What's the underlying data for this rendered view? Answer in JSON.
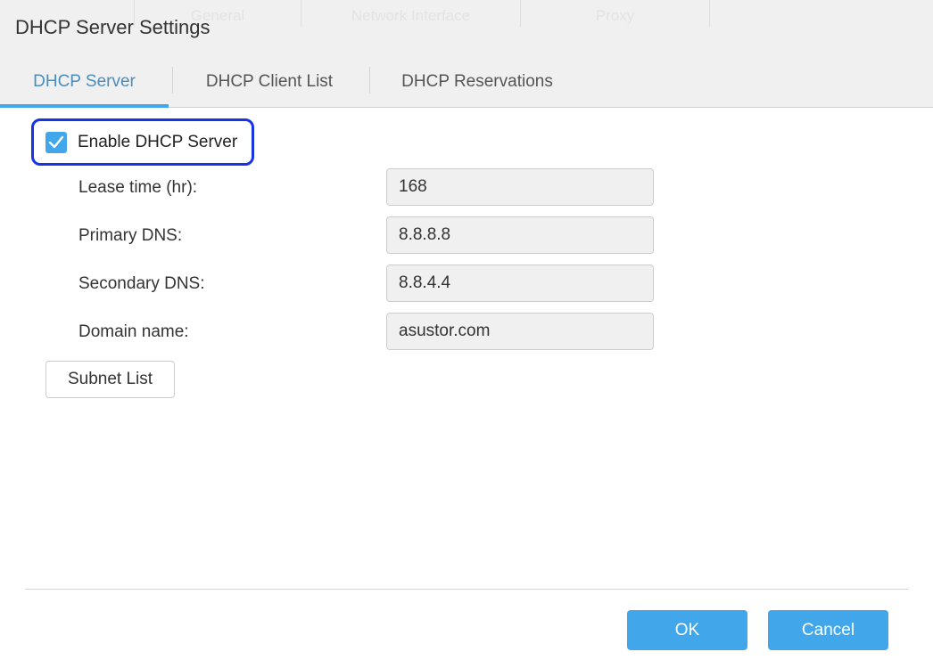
{
  "window": {
    "title": "DHCP Server Settings",
    "background_tabs": [
      "General",
      "Network Interface",
      "Proxy"
    ]
  },
  "tabs": [
    {
      "label": "DHCP Server",
      "active": true
    },
    {
      "label": "DHCP Client List",
      "active": false
    },
    {
      "label": "DHCP Reservations",
      "active": false
    }
  ],
  "enable_dhcp": {
    "label": "Enable DHCP Server",
    "checked": true
  },
  "fields": {
    "lease_time": {
      "label": "Lease time (hr):",
      "value": "168"
    },
    "primary_dns": {
      "label": "Primary DNS:",
      "value": "8.8.8.8"
    },
    "secondary_dns": {
      "label": "Secondary DNS:",
      "value": "8.8.4.4"
    },
    "domain_name": {
      "label": "Domain name:",
      "value": "asustor.com"
    }
  },
  "buttons": {
    "subnet_list": "Subnet List",
    "ok": "OK",
    "cancel": "Cancel"
  },
  "colors": {
    "accent": "#41a7ea",
    "active_tab_text": "#4b8dbb",
    "highlight_border": "#1633e6"
  }
}
